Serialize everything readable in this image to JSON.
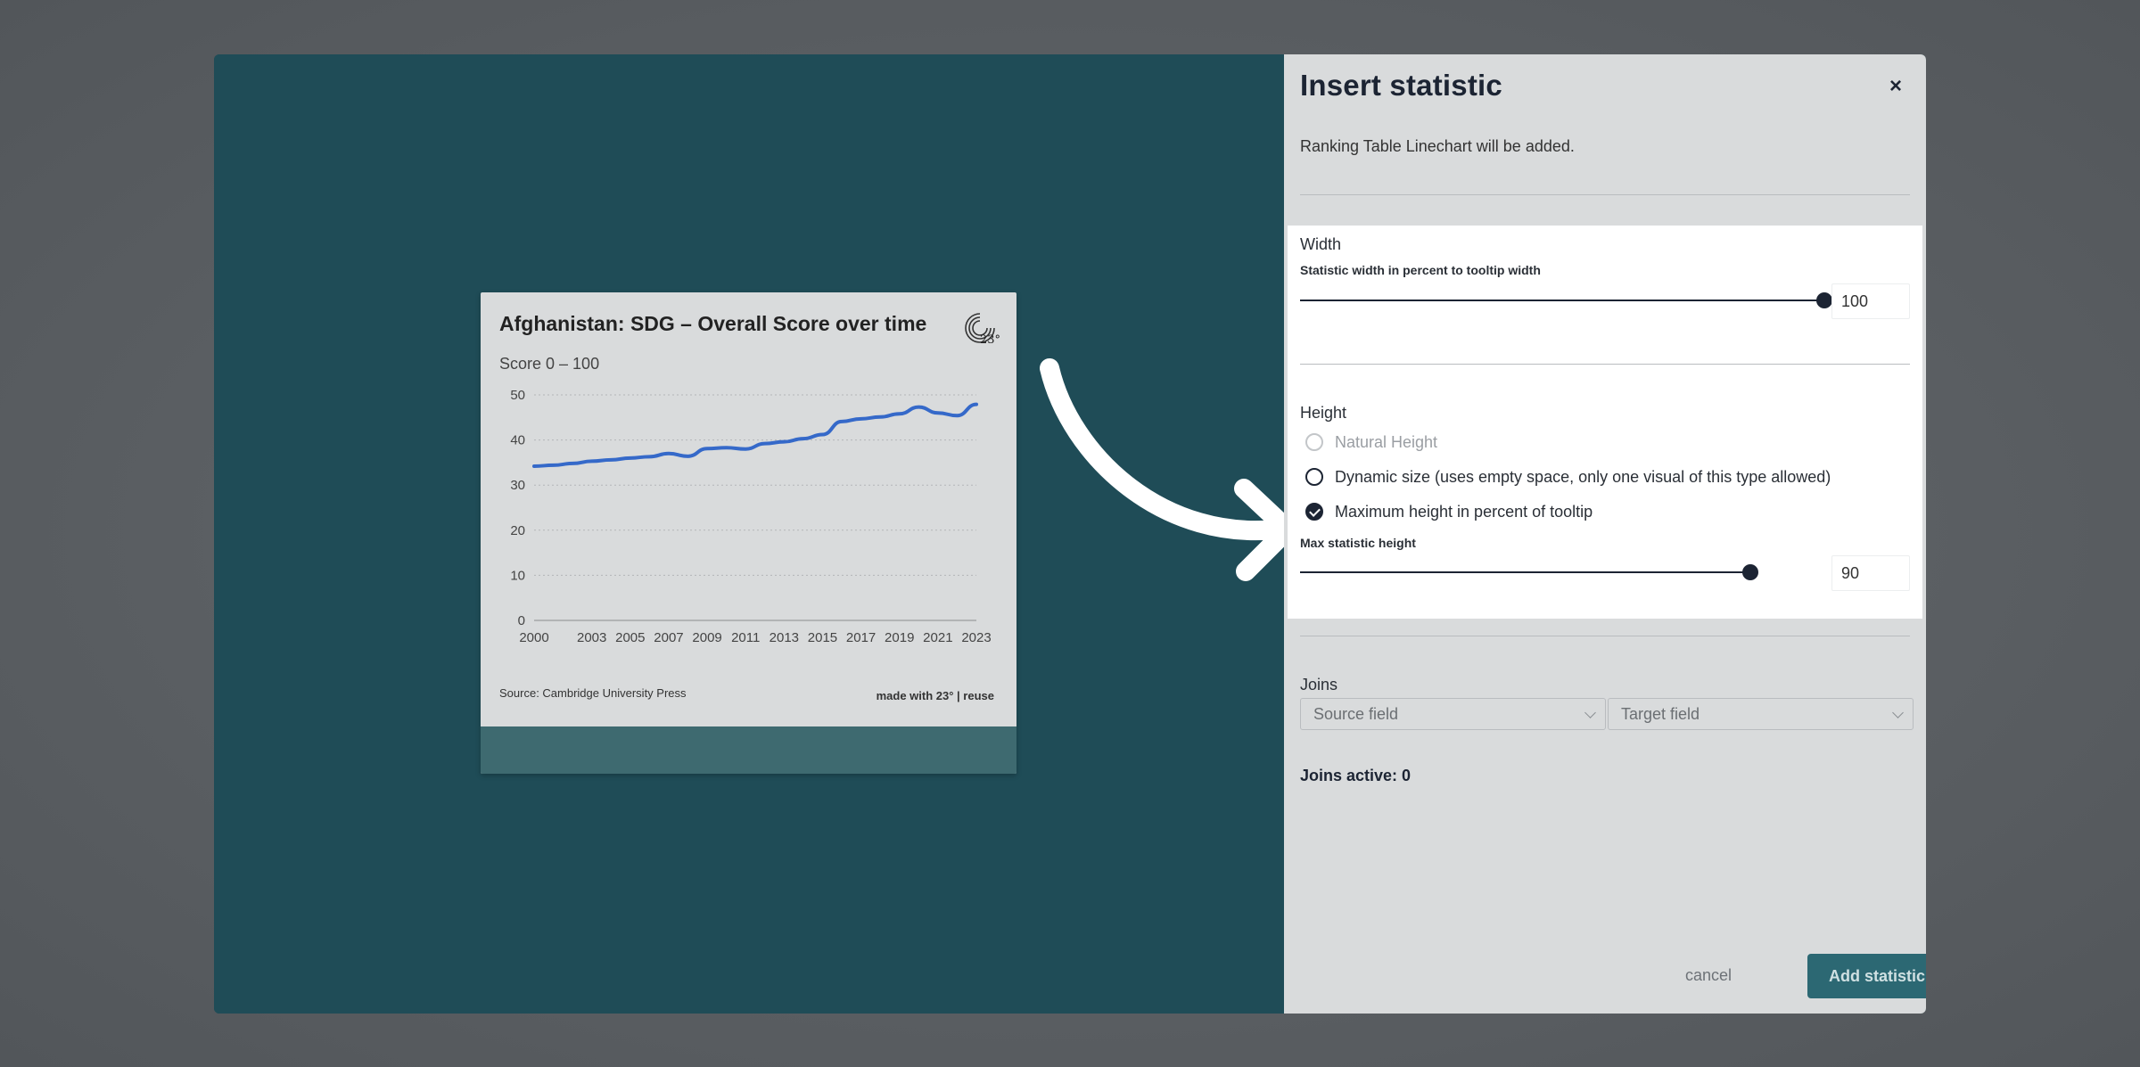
{
  "preview": {
    "card_title": "Afghanistan: SDG – Overall Score over time",
    "card_subtitle": "Score 0 – 100",
    "logo_text": "23°",
    "source": "Source: Cambridge University Press",
    "made_with": "made with 23° | reuse",
    "chart_data": {
      "type": "line",
      "title": "Afghanistan: SDG – Overall Score over time",
      "subtitle": "Score 0 – 100",
      "x_ticks": [
        "2000",
        "2003",
        "2005",
        "2007",
        "2009",
        "2011",
        "2013",
        "2015",
        "2017",
        "2019",
        "2021",
        "2023"
      ],
      "y_ticks": [
        0,
        10,
        20,
        30,
        40,
        50
      ],
      "ylim": [
        0,
        50
      ],
      "xlim": [
        2000,
        2023
      ],
      "grid": true,
      "series": [
        {
          "color": "#3569c9",
          "x": [
            2000,
            2001,
            2002,
            2003,
            2004,
            2005,
            2006,
            2007,
            2008,
            2009,
            2010,
            2011,
            2012,
            2013,
            2014,
            2015,
            2016,
            2017,
            2018,
            2019,
            2020,
            2021,
            2022,
            2023
          ],
          "y": [
            34.2,
            34.4,
            34.8,
            35.3,
            35.6,
            36.0,
            36.3,
            37.0,
            36.4,
            38.1,
            38.3,
            38.0,
            39.2,
            39.6,
            40.3,
            41.2,
            44.1,
            44.7,
            45.1,
            45.8,
            47.3,
            46.0,
            45.4,
            47.9
          ]
        }
      ]
    }
  },
  "panel": {
    "title": "Insert statistic",
    "close_glyph": "×",
    "description": "Ranking Table Linechart will be added.",
    "width": {
      "label": "Width",
      "slider_label": "Statistic width in percent to tooltip width",
      "value": 100
    },
    "height": {
      "label": "Height",
      "options": [
        {
          "label": "Natural Height",
          "state": "disabled"
        },
        {
          "label": "Dynamic size (uses empty space, only one visual of this type allowed)",
          "state": "unchecked"
        },
        {
          "label": "Maximum height in percent of tooltip",
          "state": "checked"
        }
      ],
      "slider_label": "Max statistic height",
      "value": 90
    },
    "joins": {
      "label": "Joins",
      "source_placeholder": "Source field",
      "target_placeholder": "Target field",
      "active_text": "Joins active: 0"
    },
    "buttons": {
      "cancel": "cancel",
      "add": "Add statistic"
    }
  }
}
